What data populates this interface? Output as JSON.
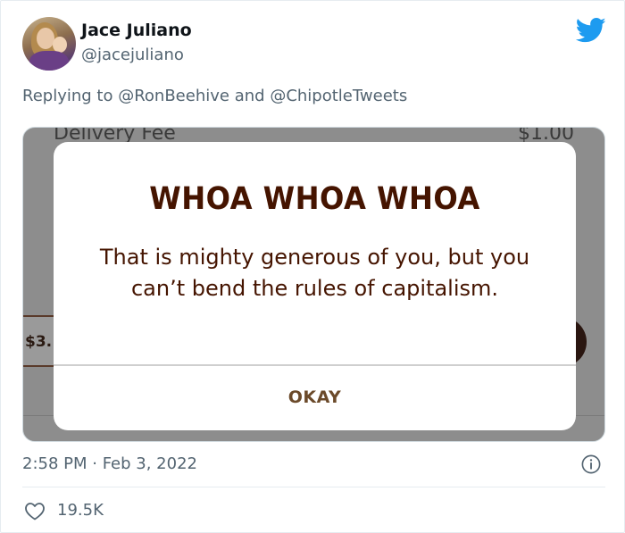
{
  "tweet": {
    "author_name": "Jace Juliano",
    "author_handle": "@jacejuliano",
    "reply_prefix": "Replying to",
    "reply_mention_1": "@RonBeehive",
    "reply_joiner": "and",
    "reply_mention_2": "@ChipotleTweets",
    "timestamp": "2:58 PM · Feb 3, 2022",
    "like_count": "19.5K"
  },
  "media": {
    "background_label": "Delivery Fee",
    "background_price": "$1.00",
    "background_tip": "$3.",
    "dialog_title": "WHOA WHOA WHOA",
    "dialog_message": "That is mighty generous of you, but you can’t bend the rules of capitalism.",
    "dialog_button": "OKAY"
  },
  "colors": {
    "twitter_blue": "#1d9bf0",
    "dialog_text": "#451400",
    "secondary_text": "#536471"
  },
  "icons": {
    "logo": "twitter-bird-icon",
    "info": "info-icon",
    "like": "heart-icon"
  }
}
